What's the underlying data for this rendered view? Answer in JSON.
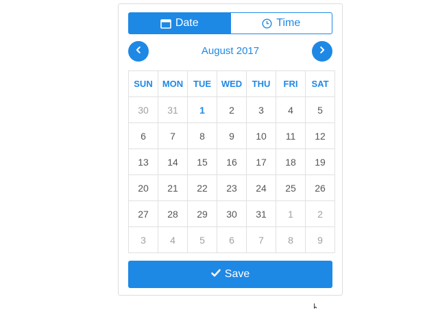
{
  "tabs": {
    "date_label": "Date",
    "time_label": "Time",
    "date_icon": "calendar-icon",
    "time_icon": "clock-icon"
  },
  "nav": {
    "month_label": "August 2017",
    "prev_icon": "chevron-left-icon",
    "next_icon": "chevron-right-icon"
  },
  "calendar": {
    "weekdays": [
      "SUN",
      "MON",
      "TUE",
      "WED",
      "THU",
      "FRI",
      "SAT"
    ],
    "weeks": [
      [
        {
          "d": "30",
          "m": 1
        },
        {
          "d": "31",
          "m": 1
        },
        {
          "d": "1",
          "t": 1
        },
        {
          "d": "2"
        },
        {
          "d": "3"
        },
        {
          "d": "4"
        },
        {
          "d": "5"
        }
      ],
      [
        {
          "d": "6"
        },
        {
          "d": "7"
        },
        {
          "d": "8"
        },
        {
          "d": "9"
        },
        {
          "d": "10"
        },
        {
          "d": "11"
        },
        {
          "d": "12"
        }
      ],
      [
        {
          "d": "13"
        },
        {
          "d": "14"
        },
        {
          "d": "15"
        },
        {
          "d": "16"
        },
        {
          "d": "17"
        },
        {
          "d": "18"
        },
        {
          "d": "19"
        }
      ],
      [
        {
          "d": "20"
        },
        {
          "d": "21"
        },
        {
          "d": "22"
        },
        {
          "d": "23"
        },
        {
          "d": "24"
        },
        {
          "d": "25"
        },
        {
          "d": "26"
        }
      ],
      [
        {
          "d": "27"
        },
        {
          "d": "28"
        },
        {
          "d": "29"
        },
        {
          "d": "30"
        },
        {
          "d": "31"
        },
        {
          "d": "1",
          "m": 1
        },
        {
          "d": "2",
          "m": 1
        }
      ],
      [
        {
          "d": "3",
          "m": 1
        },
        {
          "d": "4",
          "m": 1
        },
        {
          "d": "5",
          "m": 1
        },
        {
          "d": "6",
          "m": 1
        },
        {
          "d": "7",
          "m": 1
        },
        {
          "d": "8",
          "m": 1
        },
        {
          "d": "9",
          "m": 1
        }
      ]
    ]
  },
  "save": {
    "label": "Save",
    "icon": "checkmark-icon"
  },
  "colors": {
    "accent": "#1e88e5",
    "muted_text": "#a0a0a0",
    "day_text": "#555555",
    "grid": "#e0e0e0"
  }
}
